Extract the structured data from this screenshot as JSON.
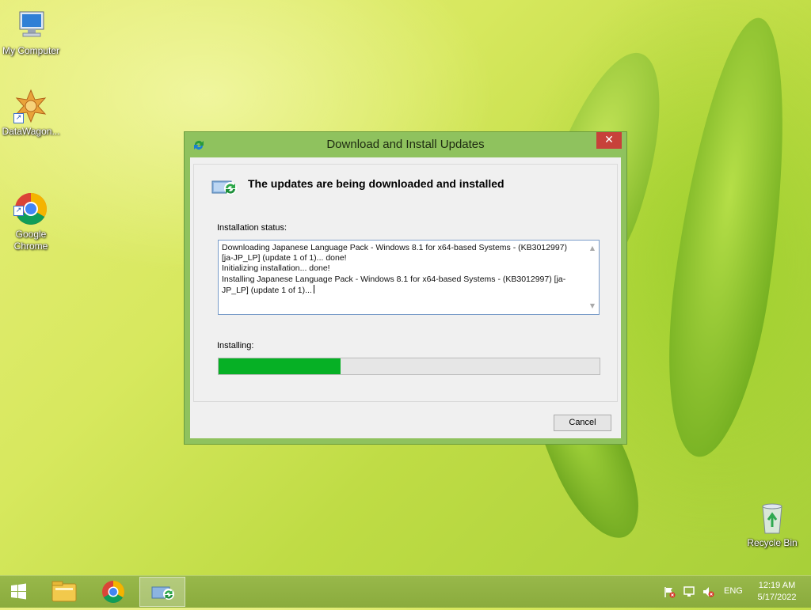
{
  "desktop": {
    "icons": [
      {
        "label": "My Computer",
        "icon": "computer-icon"
      },
      {
        "label": "DataWagon...",
        "icon": "datawagon-icon"
      },
      {
        "label": "Google\nChrome",
        "icon": "chrome-icon"
      },
      {
        "label": "Recycle Bin",
        "icon": "recycle-bin-icon"
      }
    ]
  },
  "dialog": {
    "title": "Download and Install Updates",
    "close_glyph": "✕",
    "header": "The updates are being downloaded and installed",
    "status_label": "Installation status:",
    "status_lines": "Downloading Japanese Language Pack - Windows 8.1 for x64-based Systems - (KB3012997)\n[ja-JP_LP] (update 1 of 1)... done!\nInitializing installation... done!\nInstalling Japanese Language Pack - Windows 8.1 for x64-based Systems - (KB3012997) [ja-\nJP_LP] (update 1 of 1)...",
    "installing_label": "Installing:",
    "progress_fraction": 0.32,
    "cancel_label": "Cancel"
  },
  "taskbar": {
    "items": [
      "start-button",
      "file-explorer-icon",
      "chrome-icon",
      "windows-update-icon"
    ],
    "language": "ENG",
    "time": "12:19 AM",
    "date": "5/17/2022"
  },
  "colors": {
    "progress": "#06b025",
    "window_frame": "#8fc25e",
    "close_button": "#c7413a",
    "taskbar": "#8aab3d"
  }
}
